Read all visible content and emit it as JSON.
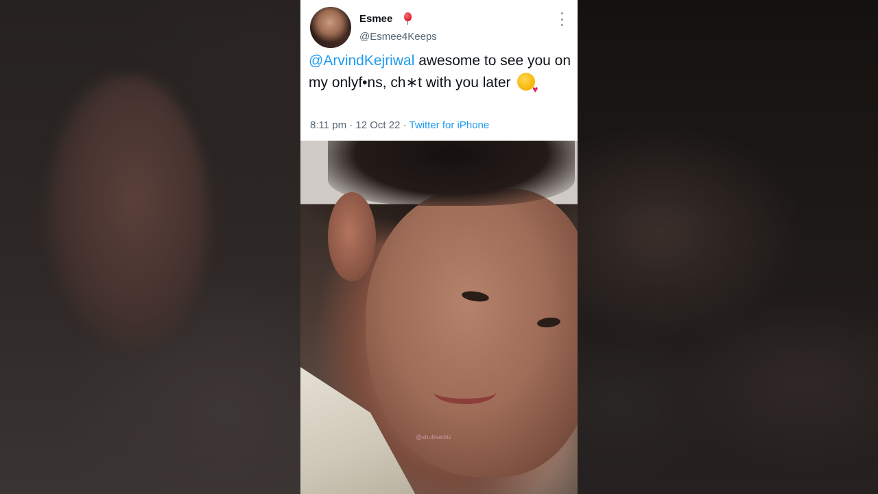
{
  "tweet": {
    "display_name": "Esmee",
    "name_emoji": "balloon-icon",
    "handle": "@Esmee4Keeps",
    "mention": "@ArvindKejriwal",
    "text": " awesome to see you on my onlyf•ns, ch∗t with you later",
    "emoji": "kissing-face-with-heart-icon",
    "timestamp": "8:11 pm · 12 Oct 22 · ",
    "source": "Twitter for iPhone"
  },
  "video": {
    "watermark": "@shubseditz"
  },
  "colors": {
    "link": "#1d9bf0",
    "text": "#0f1419",
    "muted": "#536471"
  }
}
